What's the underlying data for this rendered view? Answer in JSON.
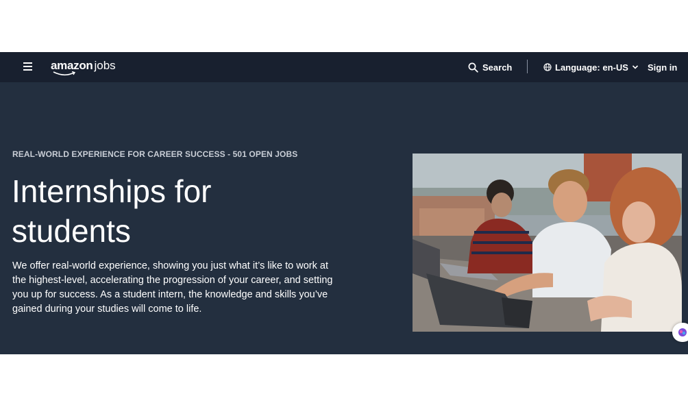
{
  "nav": {
    "logo_word": "amazon",
    "logo_suffix": "jobs",
    "search_label": "Search",
    "language_label": "Language: en-US",
    "signin_label": "Sign in"
  },
  "hero": {
    "eyebrow": "REAL-WORLD EXPERIENCE FOR CAREER SUCCESS - 501 OPEN JOBS",
    "title": "Internships for students",
    "description": "We offer real-world experience, showing you just what it’s like to work at the highest-level, accelerating the progression of your career, and setting you up for success. As a student intern, the knowledge and skills you’ve gained during your studies will come to life."
  },
  "icons": {
    "menu": "hamburger-menu-icon",
    "search": "search-icon",
    "language": "globe-icon",
    "dropdown": "chevron-down-icon",
    "assistant": "assistant-icon"
  },
  "colors": {
    "nav_bg": "#18202f",
    "hero_bg": "#232f3f",
    "text": "#ffffff",
    "brand_smile": "#ff9900"
  }
}
